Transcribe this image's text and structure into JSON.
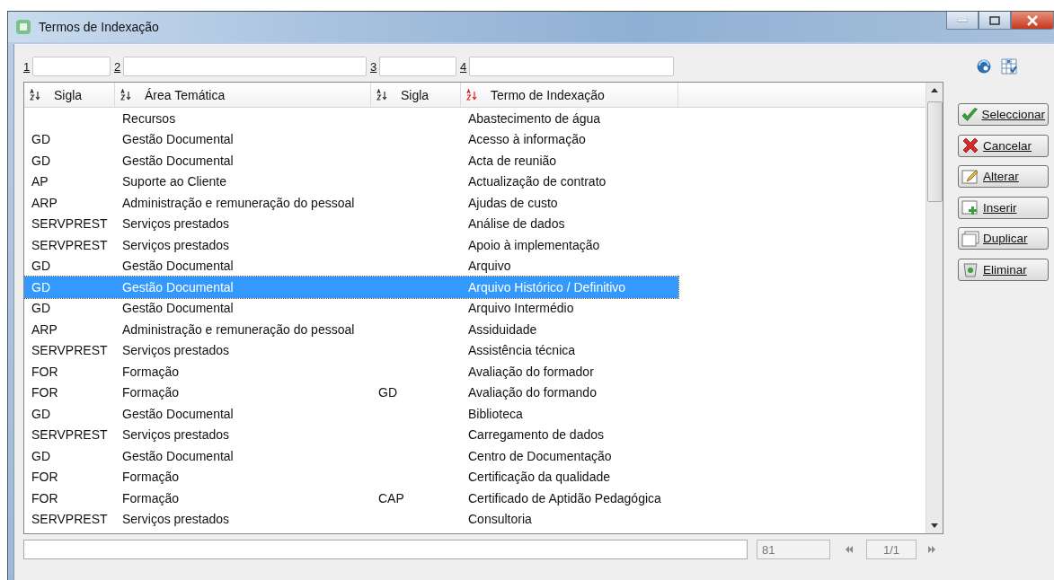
{
  "window": {
    "title": "Termos de Indexação"
  },
  "filters": [
    {
      "label": "1"
    },
    {
      "label": "2"
    },
    {
      "label": "3"
    },
    {
      "label": "4"
    }
  ],
  "table": {
    "columns": [
      {
        "label": "Sigla",
        "sorted": false
      },
      {
        "label": "Área Temática",
        "sorted": false
      },
      {
        "label": "Sigla",
        "sorted": false
      },
      {
        "label": "Termo de Indexação",
        "sorted": true
      }
    ],
    "rows": [
      {
        "cells": [
          "",
          "Recursos",
          "",
          "Abastecimento de água"
        ],
        "selected": false
      },
      {
        "cells": [
          "GD",
          "Gestão Documental",
          "",
          "Acesso à informação"
        ],
        "selected": false
      },
      {
        "cells": [
          "GD",
          "Gestão Documental",
          "",
          "Acta de reunião"
        ],
        "selected": false
      },
      {
        "cells": [
          "AP",
          "Suporte ao Cliente",
          "",
          "Actualização de contrato"
        ],
        "selected": false
      },
      {
        "cells": [
          "ARP",
          "Administração e remuneração do pessoal",
          "",
          "Ajudas de custo"
        ],
        "selected": false
      },
      {
        "cells": [
          "SERVPREST",
          "Serviços prestados",
          "",
          "Análise de dados"
        ],
        "selected": false
      },
      {
        "cells": [
          "SERVPREST",
          "Serviços prestados",
          "",
          "Apoio à implementação"
        ],
        "selected": false
      },
      {
        "cells": [
          "GD",
          "Gestão Documental",
          "",
          "Arquivo"
        ],
        "selected": false
      },
      {
        "cells": [
          "GD",
          "Gestão Documental",
          "",
          "Arquivo Histórico / Definitivo"
        ],
        "selected": true
      },
      {
        "cells": [
          "GD",
          "Gestão Documental",
          "",
          "Arquivo Intermédio"
        ],
        "selected": false
      },
      {
        "cells": [
          "ARP",
          "Administração e remuneração do pessoal",
          "",
          "Assiduidade"
        ],
        "selected": false
      },
      {
        "cells": [
          "SERVPREST",
          "Serviços prestados",
          "",
          "Assistência técnica"
        ],
        "selected": false
      },
      {
        "cells": [
          "FOR",
          "Formação",
          "",
          "Avaliação do formador"
        ],
        "selected": false
      },
      {
        "cells": [
          "FOR",
          "Formação",
          "GD",
          "Avaliação do formando"
        ],
        "selected": false
      },
      {
        "cells": [
          "GD",
          "Gestão Documental",
          "",
          "Biblioteca"
        ],
        "selected": false
      },
      {
        "cells": [
          "SERVPREST",
          "Serviços prestados",
          "",
          "Carregamento de dados"
        ],
        "selected": false
      },
      {
        "cells": [
          "GD",
          "Gestão Documental",
          "",
          "Centro de Documentação"
        ],
        "selected": false
      },
      {
        "cells": [
          "FOR",
          "Formação",
          "",
          "Certificação da qualidade"
        ],
        "selected": false
      },
      {
        "cells": [
          "FOR",
          "Formação",
          "CAP",
          "Certificado de Aptidão Pedagógica"
        ],
        "selected": false
      },
      {
        "cells": [
          "SERVPREST",
          "Serviços prestados",
          "",
          "Consultoria"
        ],
        "selected": false
      }
    ]
  },
  "buttons": [
    {
      "label": "Seleccionar",
      "kind": "check"
    },
    {
      "label": "Cancelar",
      "kind": "cross"
    },
    {
      "label": "Alterar",
      "kind": "edit"
    },
    {
      "label": "Inserir",
      "kind": "insert"
    },
    {
      "label": "Duplicar",
      "kind": "duplicate"
    },
    {
      "label": "Eliminar",
      "kind": "delete"
    }
  ],
  "status_bar": {
    "count": "81",
    "page": "1/1"
  }
}
